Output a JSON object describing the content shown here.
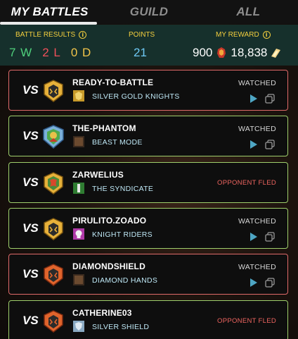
{
  "tabs": [
    {
      "label": "MY BATTLES",
      "active": true
    },
    {
      "label": "GUILD",
      "active": false
    },
    {
      "label": "ALL",
      "active": false
    }
  ],
  "summary": {
    "battle_results_label": "BATTLE RESULTS",
    "wins": "7 W",
    "losses": "2 L",
    "draws": "0 D",
    "points_label": "POINTS",
    "points": "21",
    "reward_label": "MY REWARD",
    "reward_dec": "900",
    "reward_sps": "18,838"
  },
  "colors": {
    "win": "#4fd07c",
    "loss": "#f0505a",
    "draw": "#f2c54a",
    "points": "#6ec8f4",
    "label_gold": "#f4cf3e",
    "fled": "#ef6560"
  },
  "battles": [
    {
      "vs": "VS",
      "player": "READY-TO-BATTLE",
      "guild": "SILVER GOLD KNIGHTS",
      "status": "WATCHED",
      "result": "loss",
      "avatar_icon": "knight-emblem-icon",
      "guild_icon": "gold-knight-banner-icon"
    },
    {
      "vs": "VS",
      "player": "THE-PHANTOM",
      "guild": "BEAST MODE",
      "status": "WATCHED",
      "result": "win",
      "avatar_icon": "player-avatar-icon",
      "guild_icon": "guild-banner-icon"
    },
    {
      "vs": "VS",
      "player": "ZARWELIUS",
      "guild": "THE SYNDICATE",
      "status": "OPPONENT FLED",
      "result": "win",
      "avatar_icon": "dragon-emblem-icon",
      "guild_icon": "green-banner-icon"
    },
    {
      "vs": "VS",
      "player": "PIRULITO.ZOADO",
      "guild": "KNIGHT RIDERS",
      "status": "WATCHED",
      "result": "win",
      "avatar_icon": "knight-emblem-icon",
      "guild_icon": "skull-banner-icon"
    },
    {
      "vs": "VS",
      "player": "DIAMONDSHIELD",
      "guild": "DIAMOND HANDS",
      "status": "WATCHED",
      "result": "loss",
      "avatar_icon": "fire-emblem-icon",
      "guild_icon": "guild-banner-icon"
    },
    {
      "vs": "VS",
      "player": "CATHERINE03",
      "guild": "SILVER SHIELD",
      "status": "OPPONENT FLED",
      "result": "win",
      "avatar_icon": "fire-emblem-icon",
      "guild_icon": "shield-banner-icon"
    }
  ]
}
